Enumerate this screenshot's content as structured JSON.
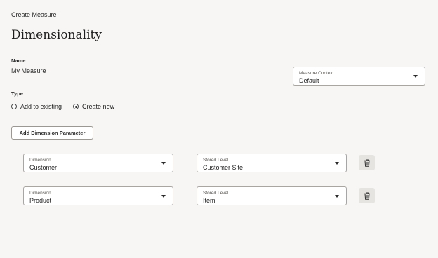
{
  "header": {
    "breadcrumb": "Create Measure",
    "page_title": "Dimensionality"
  },
  "name_field": {
    "label": "Name",
    "value": "My Measure"
  },
  "measure_context": {
    "label": "Measure Context",
    "value": "Default"
  },
  "type": {
    "label": "Type",
    "options": [
      {
        "label": "Add to existing",
        "selected": false
      },
      {
        "label": "Create new",
        "selected": true
      }
    ]
  },
  "add_dimension_button": "Add Dimension Parameter",
  "dimension_rows": [
    {
      "dimension_label": "Dimension",
      "dimension_value": "Customer",
      "stored_level_label": "Stored Level",
      "stored_level_value": "Customer Site"
    },
    {
      "dimension_label": "Dimension",
      "dimension_value": "Product",
      "stored_level_label": "Stored Level",
      "stored_level_value": "Item"
    }
  ],
  "icons": {
    "delete": "trash-icon",
    "dropdown": "chevron-down-icon"
  },
  "colors": {
    "background": "#f7f6f4",
    "field_border": "#a9a6a2",
    "delete_button_bg": "#e6e4e1"
  }
}
